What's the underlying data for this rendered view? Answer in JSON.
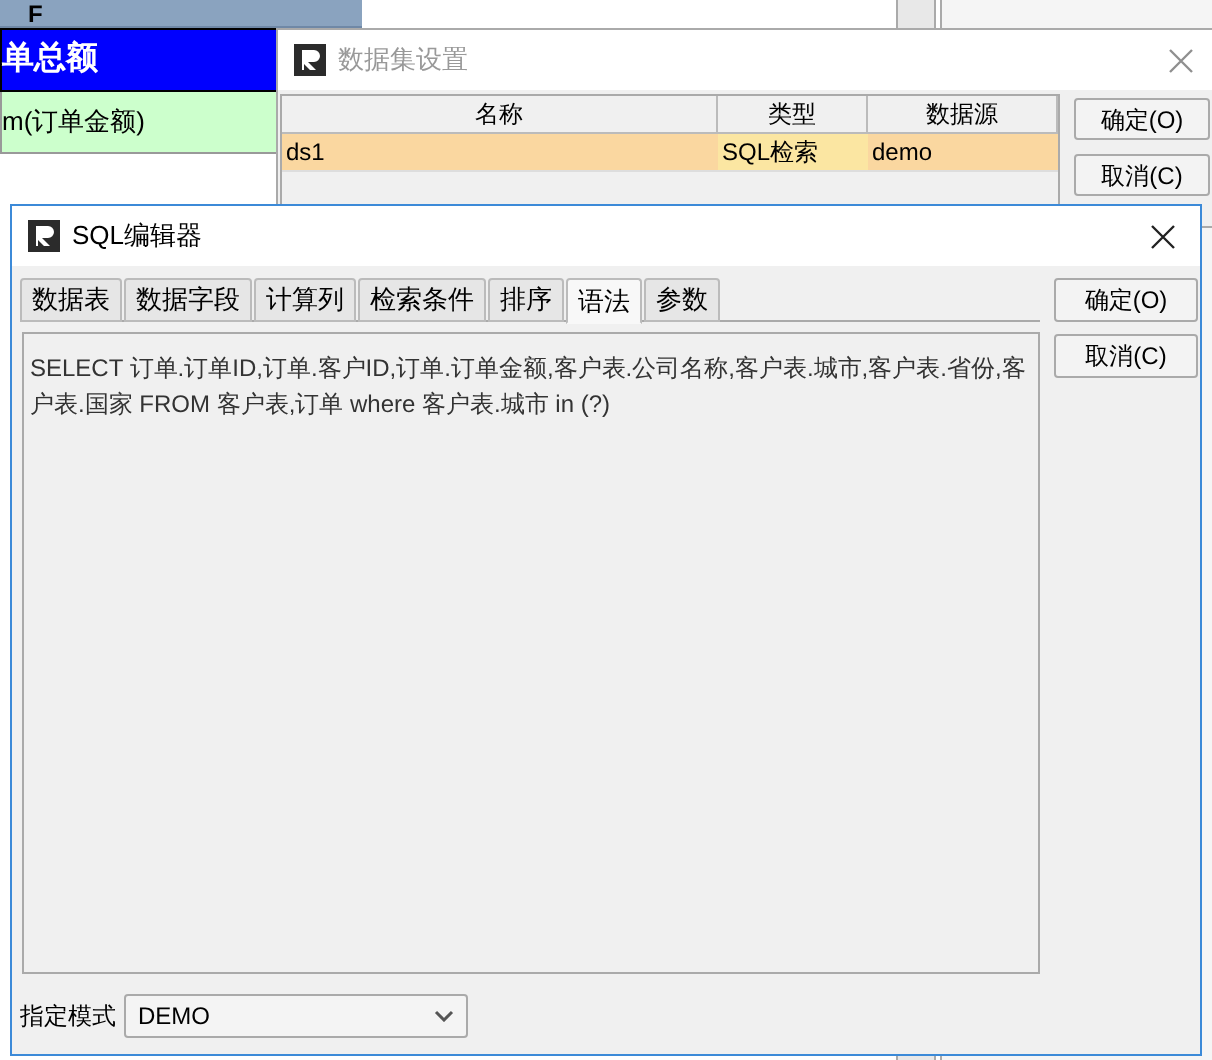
{
  "background_sheet": {
    "column_header": "F",
    "title_cell": "单总额",
    "formula_cell": "m(订单金额)"
  },
  "dataset_dialog": {
    "title": "数据集设置",
    "columns": [
      "名称",
      "类型",
      "数据源"
    ],
    "rows": [
      {
        "cells": [
          "ds1",
          "SQL检索",
          "demo"
        ],
        "selected": true
      }
    ],
    "buttons": [
      "确定(O)",
      "取消(C)"
    ]
  },
  "sql_editor": {
    "title": "SQL编辑器",
    "tabs": [
      {
        "label": "数据表",
        "selected": false
      },
      {
        "label": "数据字段",
        "selected": false
      },
      {
        "label": "计算列",
        "selected": false
      },
      {
        "label": "检索条件",
        "selected": false
      },
      {
        "label": "排序",
        "selected": false
      },
      {
        "label": "语法",
        "selected": true
      },
      {
        "label": "参数",
        "selected": false
      }
    ],
    "sql": "SELECT 订单.订单ID,订单.客户ID,订单.订单金额,客户表.公司名称,客户表.城市,客户表.省份,客户表.国家 FROM 客户表,订单 where 客户表.城市 in (?)",
    "buttons": [
      "确定(O)",
      "取消(C)"
    ],
    "mode_label": "指定模式",
    "mode_value": "DEMO"
  }
}
